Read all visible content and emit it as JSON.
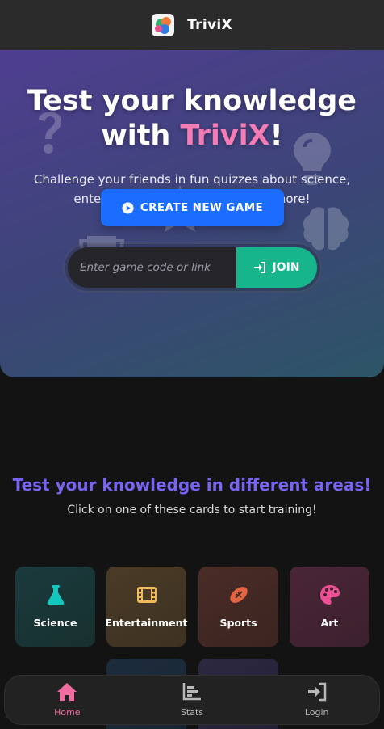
{
  "header": {
    "app_name": "TriviX"
  },
  "hero": {
    "title_line1": "Test your knowledge",
    "title_with": "with ",
    "title_brand": "TriviX",
    "title_bang": "!",
    "subtitle": "Challenge your friends in fun quizzes about science, entertainment, sports and much more!",
    "create_button": "CREATE NEW GAME",
    "join_placeholder": "Enter game code or link",
    "join_button": "JOIN"
  },
  "categories_section": {
    "title": "Test your knowledge in different areas!",
    "subtitle": "Click on one of these cards to start training!",
    "cards": [
      {
        "label": "Science",
        "icon": "flask-icon",
        "color": "#13c7bf"
      },
      {
        "label": "Entertainment",
        "icon": "film-icon",
        "color": "#f0b95a"
      },
      {
        "label": "Sports",
        "icon": "football-icon",
        "color": "#e2633f"
      },
      {
        "label": "Art",
        "icon": "palette-icon",
        "color": "#ec4f93"
      }
    ]
  },
  "bottom_nav": {
    "items": [
      {
        "label": "Home",
        "icon": "home-icon",
        "active": true
      },
      {
        "label": "Stats",
        "icon": "stats-icon",
        "active": false
      },
      {
        "label": "Login",
        "icon": "login-icon",
        "active": false
      }
    ]
  },
  "colors": {
    "brand_pink": "#f47bb3",
    "primary_blue": "#1a6dff",
    "join_green": "#17b58b",
    "section_purple": "#7765f2",
    "active_nav": "#f06ca0"
  }
}
